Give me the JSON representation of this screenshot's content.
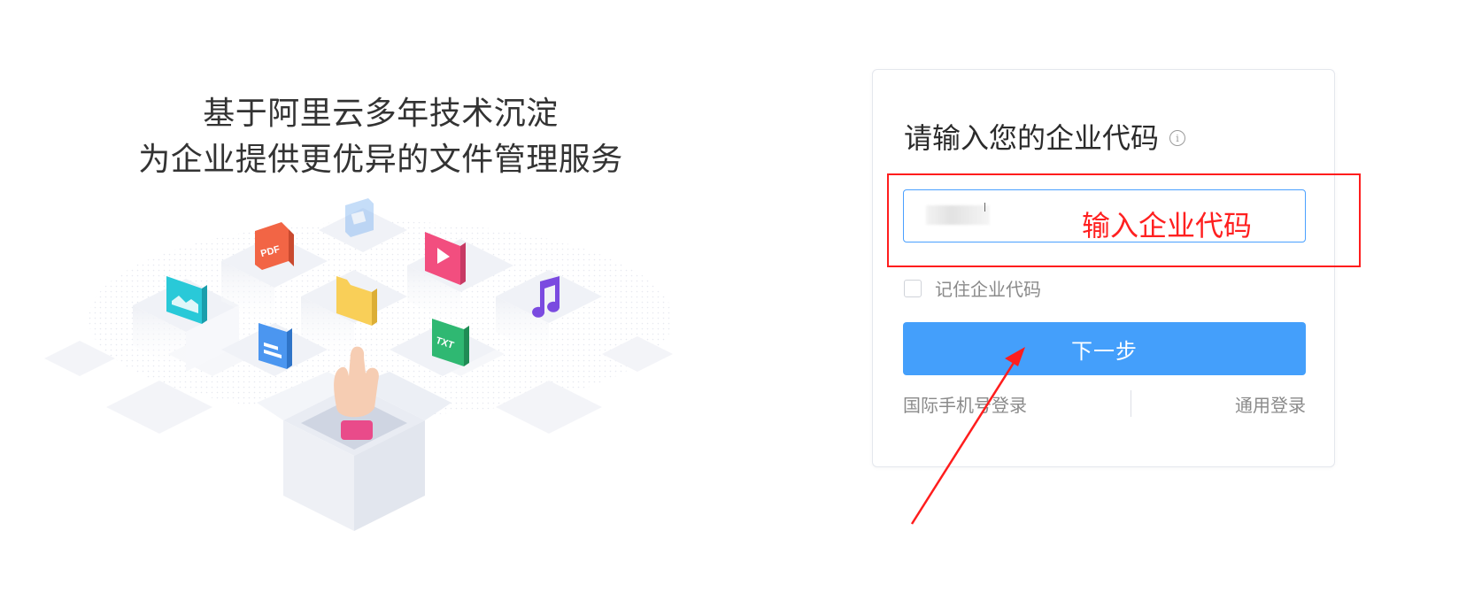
{
  "promo": {
    "line1": "基于阿里云多年技术沉淀",
    "line2": "为企业提供更优异的文件管理服务"
  },
  "illustration": {
    "icons": [
      "pdf-icon",
      "image-icon",
      "file-icon",
      "video-icon",
      "music-icon",
      "folder-icon",
      "document-icon",
      "txt-icon",
      "rock-hand-icon",
      "open-box-icon"
    ],
    "labels": {
      "pdf": "PDF",
      "txt": "TXT"
    }
  },
  "login": {
    "heading": "请输入您的企业代码",
    "info_icon_glyph": "i",
    "remember_label": "记住企业代码",
    "next_button": "下一步",
    "alt_link_left": "国际手机号登录",
    "alt_link_right": "通用登录"
  },
  "annotation": {
    "text": "输入企业代码",
    "color": "#ff1d1d"
  },
  "colors": {
    "primary": "#449ffb",
    "input_border": "#4aa0ff",
    "title_text": "#333333",
    "muted_text": "#8a8a8a"
  }
}
